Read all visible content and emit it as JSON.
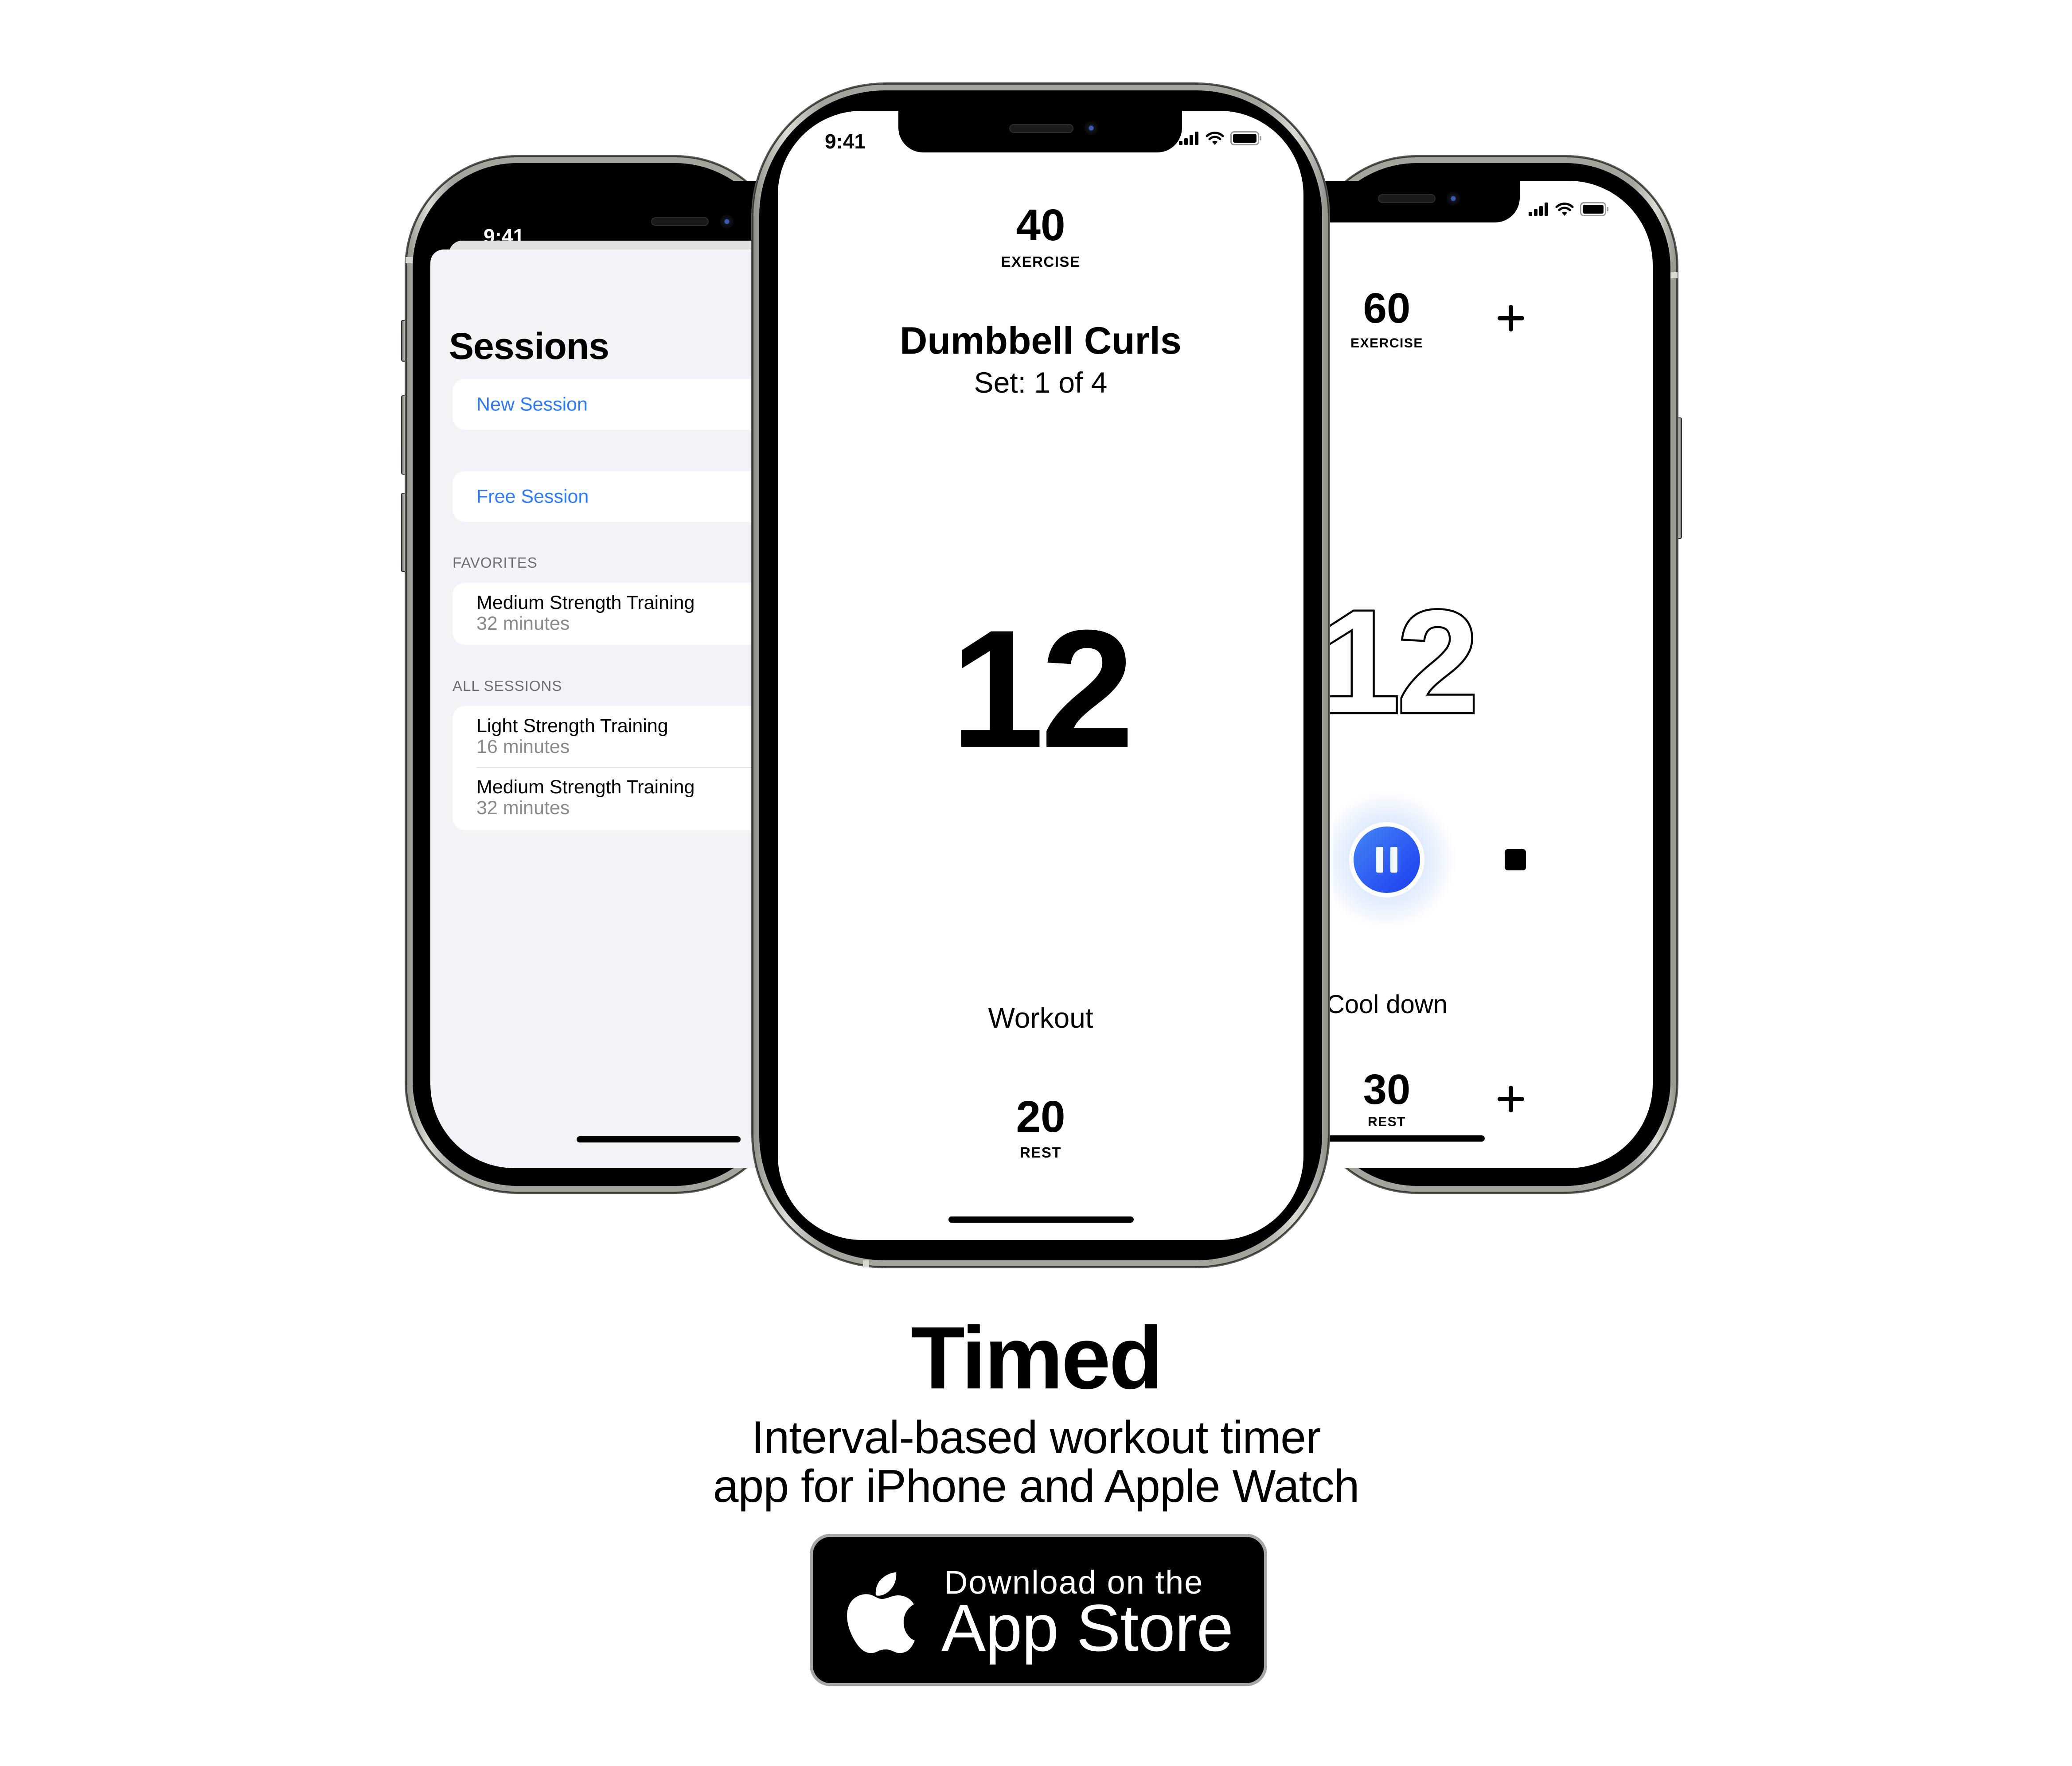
{
  "phones": {
    "left": {
      "status_time": "9:41",
      "title": "Sessions",
      "actions": [
        {
          "label": "New Session"
        },
        {
          "label": "Free Session"
        }
      ],
      "sections": [
        {
          "header": "FAVORITES",
          "items": [
            {
              "title": "Medium Strength Training",
              "subtitle": "32 minutes"
            }
          ]
        },
        {
          "header": "ALL SESSIONS",
          "items": [
            {
              "title": "Light Strength Training",
              "subtitle": "16 minutes"
            },
            {
              "title": "Medium Strength Training",
              "subtitle": "32 minutes"
            }
          ]
        }
      ]
    },
    "center": {
      "status_time": "9:41",
      "exercise_value": "40",
      "exercise_label": "EXERCISE",
      "exercise_name": "Dumbbell Curls",
      "set_label": "Set: 1 of 4",
      "timer": "12",
      "phase": "Workout",
      "rest_value": "20",
      "rest_label": "REST"
    },
    "right": {
      "exercise_value": "60",
      "exercise_label": "EXERCISE",
      "timer": "12",
      "phase": "Cool down",
      "rest_value": "30",
      "rest_label": "REST",
      "pause_icon": "pause-icon",
      "stop_icon": "stop-icon",
      "plus_icon": "plus-icon"
    }
  },
  "marketing": {
    "app_name": "Timed",
    "tagline_line1": "Interval-based workout timer",
    "tagline_line2": "app for iPhone and Apple Watch"
  },
  "badge": {
    "small_text": "Download on the",
    "large_text": "App Store",
    "icon": "apple-logo-icon"
  },
  "colors": {
    "link_blue": "#2f7bf5",
    "pause_blue": "#2d5cf2",
    "list_background": "#f2f2f7",
    "secondary_text": "#8a8a8e"
  }
}
